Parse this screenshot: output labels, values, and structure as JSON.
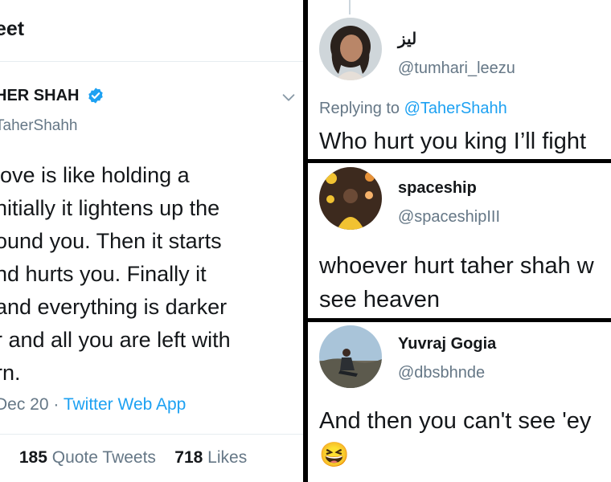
{
  "main_tweet": {
    "header": "eet",
    "name": "HER SHAH",
    "handle": "TaherShahh",
    "lines": [
      "love is like holding a",
      "nitially it lightens up the",
      "ound you. Then it starts",
      "nd hurts you. Finally it",
      "and everything is darker",
      "r and all you are left with",
      "rn."
    ],
    "meta_date": "Dec 20 · ",
    "meta_source": "Twitter Web App",
    "stats": {
      "partial_label": "s",
      "quote_count": "185",
      "quote_label": "Quote Tweets",
      "likes_count": "718",
      "likes_label": "Likes"
    }
  },
  "replies": [
    {
      "name": "ليز",
      "handle": "@tumhari_leezu",
      "replying_label": "Replying to",
      "replying_to": "@TaherShahh",
      "text": "Who hurt you king I’ll fight"
    },
    {
      "name": "spaceship",
      "handle": "@spaceshipIII",
      "text_lines": [
        "whoever hurt taher shah w",
        "see heaven"
      ]
    },
    {
      "name": "Yuvraj Gogia",
      "handle": "@dbsbhnde",
      "text": "And then you can't see 'ey",
      "emoji": "😆"
    }
  ],
  "colors": {
    "link": "#1da1f2",
    "muted": "#657786",
    "divider": "#000000"
  },
  "icons": [
    "verified-badge-icon",
    "chevron-down-icon"
  ]
}
